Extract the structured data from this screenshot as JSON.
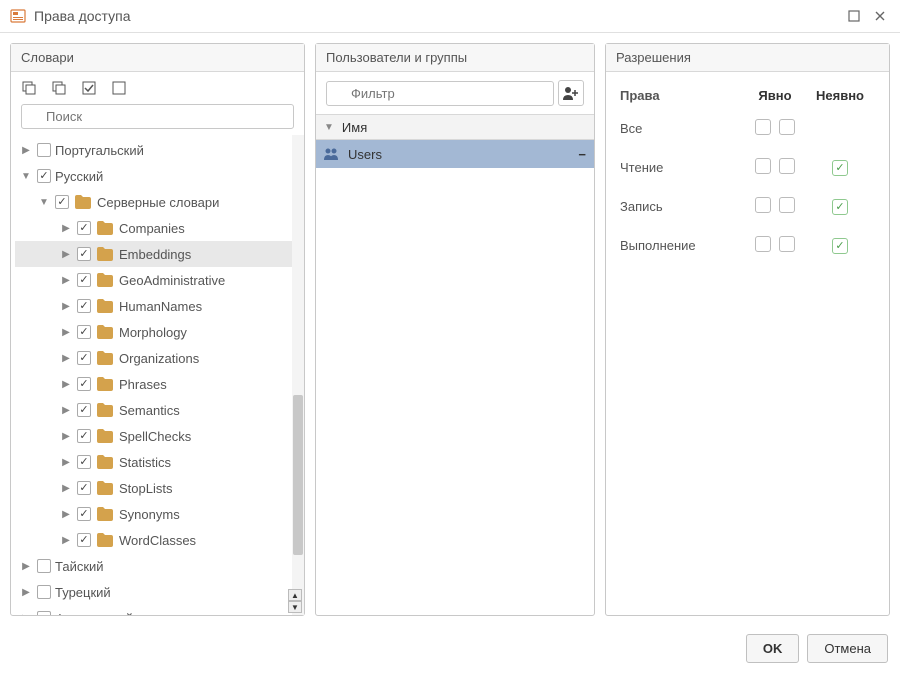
{
  "window": {
    "title": "Права доступа"
  },
  "panels": {
    "dict": {
      "title": "Словари",
      "search_placeholder": "Поиск"
    },
    "users": {
      "title": "Пользователи и группы",
      "filter_placeholder": "Фильтр",
      "col_name": "Имя"
    },
    "perms": {
      "title": "Разрешения"
    }
  },
  "tree": {
    "top": [
      {
        "label": "Португальский",
        "checked": false,
        "expandable": true
      },
      {
        "label": "Русский",
        "checked": true,
        "expandable": true,
        "expanded": true
      }
    ],
    "server_folder": {
      "label": "Серверные словари",
      "checked": true
    },
    "items": [
      {
        "label": "Companies",
        "checked": true
      },
      {
        "label": "Embeddings",
        "checked": true,
        "selected": true
      },
      {
        "label": "GeoAdministrative",
        "checked": true
      },
      {
        "label": "HumanNames",
        "checked": true
      },
      {
        "label": "Morphology",
        "checked": true
      },
      {
        "label": "Organizations",
        "checked": true
      },
      {
        "label": "Phrases",
        "checked": true
      },
      {
        "label": "Semantics",
        "checked": true
      },
      {
        "label": "SpellChecks",
        "checked": true
      },
      {
        "label": "Statistics",
        "checked": true
      },
      {
        "label": "StopLists",
        "checked": true
      },
      {
        "label": "Synonyms",
        "checked": true
      },
      {
        "label": "WordClasses",
        "checked": true
      }
    ],
    "bottom": [
      {
        "label": "Тайский",
        "checked": false
      },
      {
        "label": "Турецкий",
        "checked": false
      },
      {
        "label": "Французский",
        "checked": false
      }
    ]
  },
  "users": {
    "rows": [
      {
        "label": "Users"
      }
    ]
  },
  "perms": {
    "head": {
      "c1": "Права",
      "c2": "Явно",
      "c3": "Неявно"
    },
    "rows": [
      {
        "label": "Все",
        "implicit": false
      },
      {
        "label": "Чтение",
        "implicit": true
      },
      {
        "label": "Запись",
        "implicit": true
      },
      {
        "label": "Выполнение",
        "implicit": true
      }
    ]
  },
  "footer": {
    "ok": "OK",
    "cancel": "Отмена"
  }
}
